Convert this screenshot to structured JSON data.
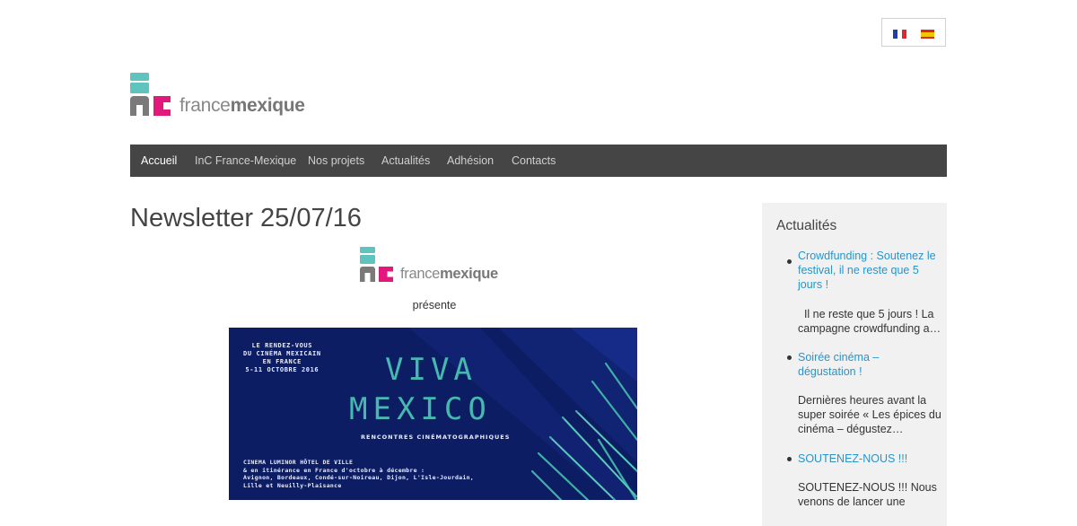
{
  "languages": [
    {
      "name": "Français",
      "code": "fr"
    },
    {
      "name": "Español",
      "code": "es"
    }
  ],
  "logo": {
    "text_light": "france",
    "text_bold": "mexique"
  },
  "nav": {
    "items": [
      "Accueil",
      "InC France-Mexique",
      "Nos projets",
      "Actualités",
      "Adhésion",
      "Contacts"
    ],
    "active": "Accueil"
  },
  "main": {
    "title": "Newsletter 25/07/16",
    "presente": "présente",
    "banner": {
      "intro": "LE RENDEZ-VOUS\nDU CINÉMA MEXICAIN\nEN FRANCE\n5-11 OCTOBRE 2016",
      "title_line1": "VIVA",
      "title_line2": "MEXICO",
      "subtitle": "RENCONTRES CINÉMATOGRAPHIQUES",
      "venue": "CINEMA LUMINOR HÔTEL DE VILLE\n& en itinérance en France d'octobre à décembre :\nAvignon, Bordeaux, Condé-sur-Noireau, Dijon, L'Isle-Jourdain,\nLille et Neuilly-Plaisance"
    }
  },
  "sidebar": {
    "title": "Actualités",
    "items": [
      {
        "link": "Crowdfunding : Soutenez le festival, il ne reste que 5 jours !",
        "excerpt": "  Il ne reste que 5 jours ! La campagne crowdfunding a…"
      },
      {
        "link": "Soirée cinéma – dégustation !",
        "excerpt": "Dernières heures avant la super soirée « Les épices du cinéma – dégustez…"
      },
      {
        "link": "SOUTENEZ-NOUS !!!",
        "excerpt": "SOUTENEZ-NOUS !!! Nous venons de lancer une"
      }
    ]
  },
  "colors": {
    "logo_teal": "#5ec4bd",
    "logo_gray": "#7a7a7a",
    "logo_magenta": "#e2197c",
    "nav_bg": "#454545",
    "link": "#2a94c8",
    "banner_bg": "#0d1d63"
  }
}
